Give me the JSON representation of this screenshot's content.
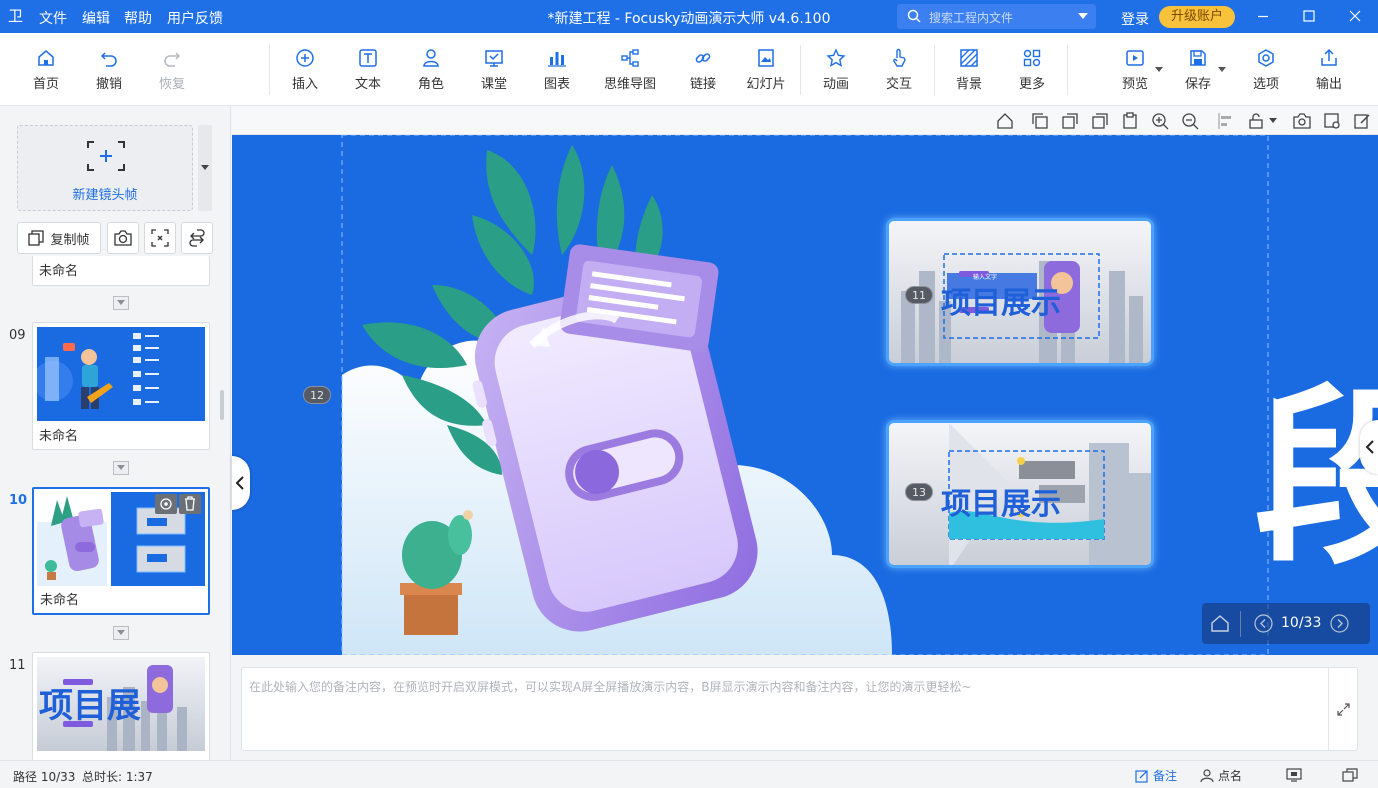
{
  "titlebar": {
    "logo_glyph": "卫",
    "menu": [
      "文件",
      "编辑",
      "帮助",
      "用户反馈"
    ],
    "title": "*新建工程 - Focusky动画演示大师  v4.6.100",
    "search_placeholder": "搜索工程内文件",
    "login": "登录",
    "upgrade": "升级账户"
  },
  "toolbar": {
    "home": "首页",
    "undo": "撤销",
    "redo": "恢复",
    "insert": "插入",
    "text": "文本",
    "role": "角色",
    "classroom": "课堂",
    "chart": "图表",
    "mindmap": "思维导图",
    "link": "链接",
    "slides": "幻灯片",
    "animation": "动画",
    "interaction": "交互",
    "background": "背景",
    "more": "更多",
    "preview": "预览",
    "save": "保存",
    "options": "选项",
    "export": "输出"
  },
  "left_panel": {
    "new_frame": "新建镜头帧",
    "copy_frame": "复制帧",
    "prev_item_name": "未命名",
    "slides": [
      {
        "num": "09",
        "name": "未命名"
      },
      {
        "num": "10",
        "name": "未命名"
      },
      {
        "num": "11",
        "name": ""
      }
    ]
  },
  "canvas": {
    "frame_badges": [
      "11",
      "12",
      "13"
    ],
    "card_title_1": "项目展示",
    "card_title_2": "项目展示",
    "tiny_label": "输入文字",
    "big_text": "段无",
    "nav_counter": "10/33"
  },
  "notes": {
    "placeholder": "在此处输入您的备注内容，在预览时开启双屏模式，可以实现A屏全屏播放演示内容，B屏显示演示内容和备注内容，让您的演示更轻松~"
  },
  "statusbar": {
    "path": "路径 10/33",
    "duration": "总时长: 1:37",
    "notes": "备注",
    "rollcall": "点名"
  },
  "colors": {
    "brand_blue": "#1f6fe6",
    "canvas_blue": "#1a6ae1",
    "upgrade_gold": "#f8c23c",
    "purple": "#9b7be0"
  }
}
